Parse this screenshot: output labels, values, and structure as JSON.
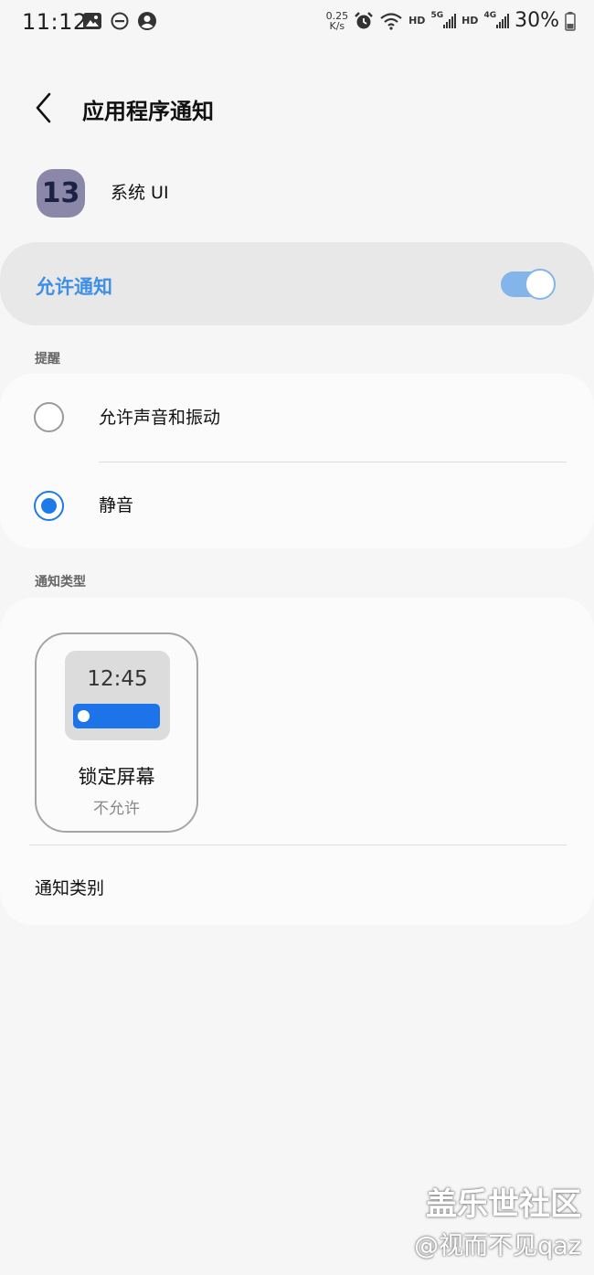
{
  "status_bar": {
    "time": "11:12",
    "speed_value": "0.25",
    "speed_unit": "K/s",
    "hd1": "HD",
    "net1": "5G",
    "hd2": "HD",
    "net2": "4G",
    "battery": "30%",
    "icons": [
      "image-icon",
      "do-not-disturb-icon",
      "account-icon",
      "alarm-icon",
      "wifi-icon",
      "signal-icon",
      "battery-icon"
    ]
  },
  "header": {
    "title": "应用程序通知"
  },
  "app": {
    "icon_text": "13",
    "name": "系统 UI"
  },
  "allow": {
    "label": "允许通知",
    "enabled": true
  },
  "alerts": {
    "section_label": "提醒",
    "options": [
      {
        "label": "允许声音和振动",
        "selected": false
      },
      {
        "label": "静音",
        "selected": true
      }
    ]
  },
  "notification_types": {
    "section_label": "通知类型",
    "lock_screen": {
      "preview_time": "12:45",
      "title": "锁定屏幕",
      "status": "不允许"
    },
    "categories_label": "通知类别"
  },
  "watermark": {
    "line1": "盖乐世社区",
    "line2": "@视而不见qaz"
  },
  "colors": {
    "accent": "#3e8fe6",
    "radio_selected": "#1c7be8"
  }
}
